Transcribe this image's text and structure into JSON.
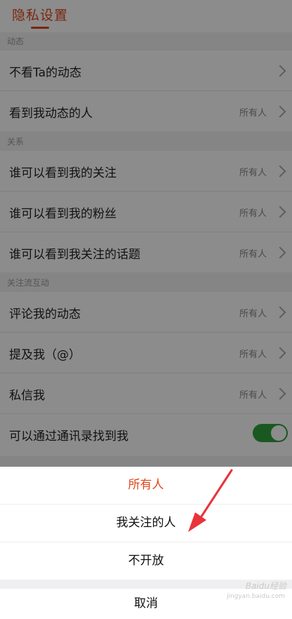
{
  "header": {
    "title": "隐私设置"
  },
  "sections": {
    "dynamics": {
      "label": "动态",
      "items": [
        {
          "label": "不看Ta的动态",
          "value": ""
        },
        {
          "label": "看到我动态的人",
          "value": "所有人"
        }
      ]
    },
    "relations": {
      "label": "关系",
      "items": [
        {
          "label": "谁可以看到我的关注",
          "value": "所有人"
        },
        {
          "label": "谁可以看到我的粉丝",
          "value": "所有人"
        },
        {
          "label": "谁可以看到我关注的话题",
          "value": "所有人"
        }
      ]
    },
    "interaction": {
      "label": "关注流互动",
      "items": [
        {
          "label": "评论我的动态",
          "value": "所有人"
        },
        {
          "label": "提及我（@）",
          "value": "所有人"
        },
        {
          "label": "私信我",
          "value": "所有人"
        },
        {
          "label": "可以通过通讯录找到我",
          "toggle": true
        }
      ]
    }
  },
  "action_sheet": {
    "options": [
      {
        "label": "所有人",
        "selected": true
      },
      {
        "label": "我关注的人",
        "selected": false
      },
      {
        "label": "不开放",
        "selected": false
      }
    ],
    "cancel": "取消"
  },
  "annotation": {
    "arrow_color": "#e8333a"
  },
  "watermark": {
    "brand": "Baidu经验",
    "sub": "jingyan.baidu.com"
  },
  "colors": {
    "accent": "#e0461a",
    "toggle_on": "#2fa33c"
  }
}
